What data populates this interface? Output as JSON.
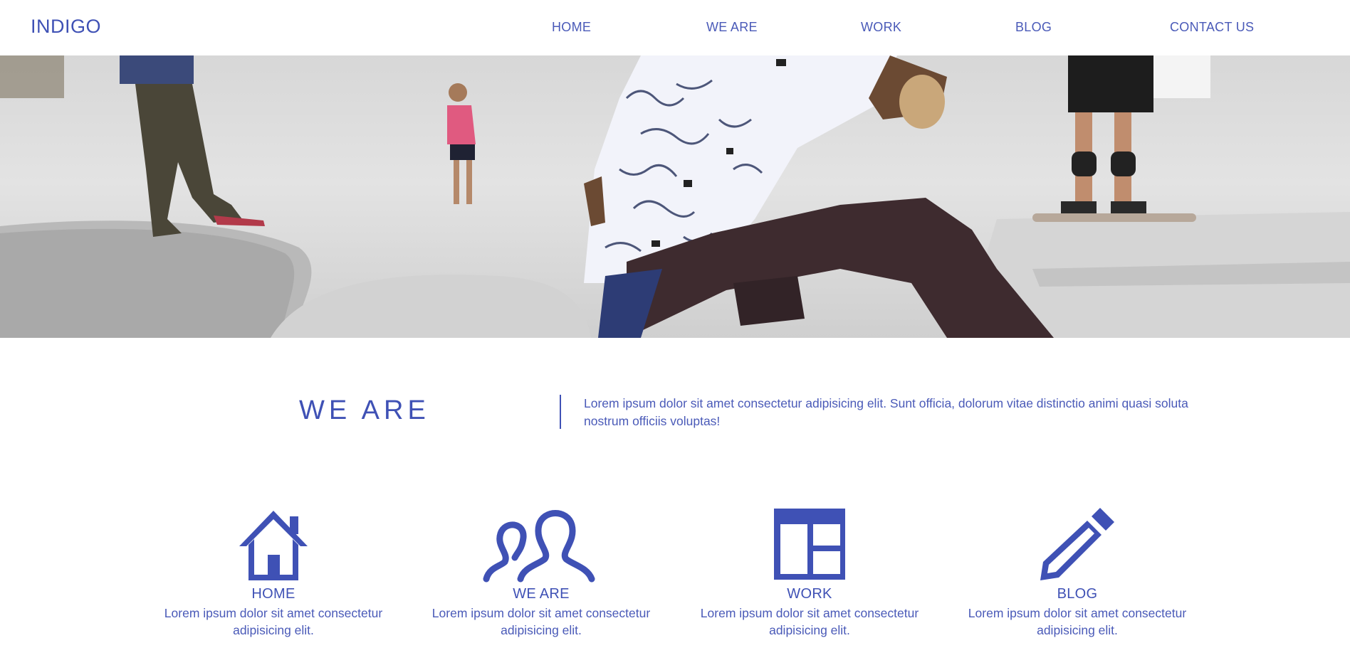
{
  "header": {
    "logo": "INDIGO",
    "nav": [
      "HOME",
      "WE ARE",
      "WORK",
      "BLOG",
      "CONTACT US"
    ]
  },
  "hero": {
    "image": "skatepark-photo"
  },
  "about": {
    "title": "WE ARE",
    "text": "Lorem ipsum dolor sit amet consectetur adipisicing elit. Sunt officia, dolorum vitae distinctio animi quasi soluta nostrum officiis voluptas!"
  },
  "features": [
    {
      "icon": "home-icon",
      "title": "HOME",
      "desc": "Lorem ipsum dolor sit amet consectetur adipisicing elit."
    },
    {
      "icon": "users-icon",
      "title": "WE ARE",
      "desc": "Lorem ipsum dolor sit amet consectetur adipisicing elit."
    },
    {
      "icon": "layout-icon",
      "title": "WORK",
      "desc": "Lorem ipsum dolor sit amet consectetur adipisicing elit."
    },
    {
      "icon": "pencil-icon",
      "title": "BLOG",
      "desc": "Lorem ipsum dolor sit amet consectetur adipisicing elit."
    }
  ],
  "colors": {
    "accent": "#3f51b5",
    "text": "#4a5ab8",
    "background": "#ffffff"
  }
}
